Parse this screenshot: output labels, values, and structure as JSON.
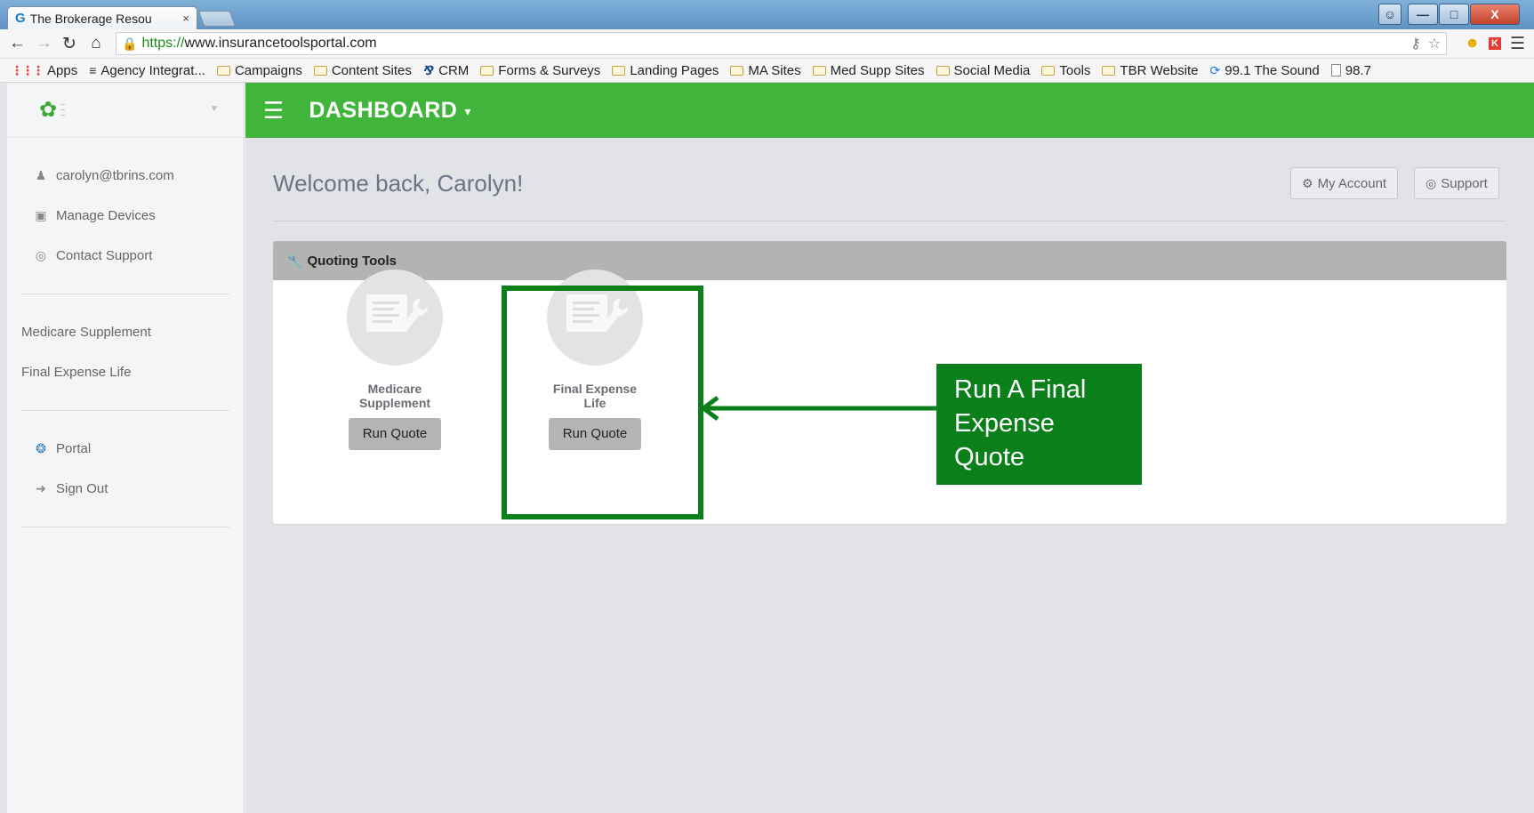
{
  "browser": {
    "tab_title": "The Brokerage Resou",
    "tab_close": "×",
    "url_scheme": "https://",
    "url_rest": "www.insurancetoolsportal.com",
    "window_close": "X",
    "bookmarks": [
      {
        "label": "Apps",
        "icon": "apps-icon"
      },
      {
        "label": "Agency Integrat...",
        "icon": "list-icon"
      },
      {
        "label": "Campaigns",
        "icon": "folder-icon"
      },
      {
        "label": "Content Sites",
        "icon": "folder-icon"
      },
      {
        "label": "CRM",
        "icon": "crm-icon"
      },
      {
        "label": "Forms & Surveys",
        "icon": "folder-icon"
      },
      {
        "label": "Landing Pages",
        "icon": "folder-icon"
      },
      {
        "label": "MA Sites",
        "icon": "folder-icon"
      },
      {
        "label": "Med Supp Sites",
        "icon": "folder-icon"
      },
      {
        "label": "Social Media",
        "icon": "folder-icon"
      },
      {
        "label": "Tools",
        "icon": "folder-icon"
      },
      {
        "label": "TBR Website",
        "icon": "folder-icon"
      },
      {
        "label": "99.1 The Sound",
        "icon": "radio-icon"
      },
      {
        "label": "98.7",
        "icon": "page-icon"
      }
    ]
  },
  "sidebar": {
    "account_items": [
      {
        "label": "carolyn@tbrins.com",
        "icon": "user-icon"
      },
      {
        "label": "Manage Devices",
        "icon": "laptop-icon"
      },
      {
        "label": "Contact Support",
        "icon": "lifebuoy-icon"
      }
    ],
    "product_items": [
      {
        "label": "Medicare Supplement"
      },
      {
        "label": "Final Expense Life"
      }
    ],
    "nav_items": [
      {
        "label": "Portal",
        "icon": "portal-icon"
      },
      {
        "label": "Sign Out",
        "icon": "sign-out-icon"
      }
    ]
  },
  "topbar": {
    "title": "DASHBOARD"
  },
  "main": {
    "welcome": "Welcome back, Carolyn!",
    "my_account": "My Account",
    "support": "Support",
    "panel_title": "Quoting Tools",
    "tools": [
      {
        "name_line1": "Medicare",
        "name_line2": "Supplement",
        "button": "Run Quote"
      },
      {
        "name_line1": "Final Expense",
        "name_line2": "Life",
        "button": "Run Quote"
      }
    ]
  },
  "annotation": {
    "callout_text": "Run A Final Expense Quote",
    "color": "#0b7f1a"
  },
  "colors": {
    "brand_green": "#41b53b",
    "panel_header": "#b2b3b2"
  }
}
